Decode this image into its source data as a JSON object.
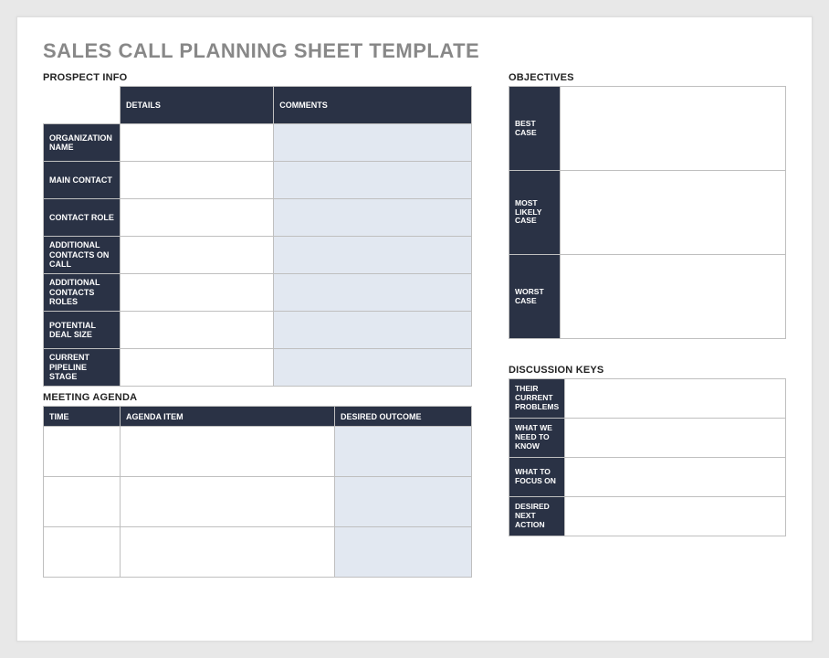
{
  "title": "SALES CALL PLANNING SHEET TEMPLATE",
  "prospect": {
    "section": "PROSPECT INFO",
    "headers": {
      "details": "DETAILS",
      "comments": "COMMENTS"
    },
    "rows": [
      {
        "label": "ORGANIZATION NAME",
        "details": "",
        "comments": ""
      },
      {
        "label": "MAIN CONTACT",
        "details": "",
        "comments": ""
      },
      {
        "label": "CONTACT ROLE",
        "details": "",
        "comments": ""
      },
      {
        "label": "ADDITIONAL CONTACTS ON CALL",
        "details": "",
        "comments": ""
      },
      {
        "label": "ADDITIONAL CONTACTS ROLES",
        "details": "",
        "comments": ""
      },
      {
        "label": "POTENTIAL DEAL SIZE",
        "details": "",
        "comments": ""
      },
      {
        "label": "CURRENT PIPELINE STAGE",
        "details": "",
        "comments": ""
      }
    ]
  },
  "agenda": {
    "section": "MEETING AGENDA",
    "headers": {
      "time": "TIME",
      "item": "AGENDA ITEM",
      "outcome": "DESIRED OUTCOME"
    },
    "rows": [
      {
        "time": "",
        "item": "",
        "outcome": ""
      },
      {
        "time": "",
        "item": "",
        "outcome": ""
      },
      {
        "time": "",
        "item": "",
        "outcome": ""
      }
    ]
  },
  "objectives": {
    "section": "OBJECTIVES",
    "rows": [
      {
        "label": "BEST CASE",
        "value": ""
      },
      {
        "label": "MOST LIKELY CASE",
        "value": ""
      },
      {
        "label": "WORST CASE",
        "value": ""
      }
    ]
  },
  "discussion": {
    "section": "DISCUSSION KEYS",
    "rows": [
      {
        "label": "THEIR CURRENT PROBLEMS",
        "value": ""
      },
      {
        "label": "WHAT WE NEED TO KNOW",
        "value": ""
      },
      {
        "label": "WHAT TO FOCUS ON",
        "value": ""
      },
      {
        "label": "DESIRED NEXT ACTION",
        "value": ""
      }
    ]
  }
}
